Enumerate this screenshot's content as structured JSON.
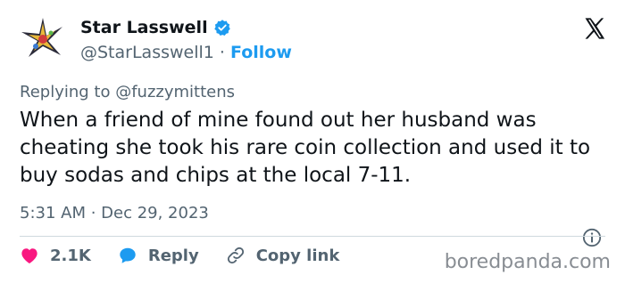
{
  "author": {
    "name": "Star Lasswell",
    "handle": "@StarLasswell1",
    "separator": "·",
    "follow_label": "Follow"
  },
  "tweet": {
    "replying_to": "Replying to @fuzzymittens",
    "text": "When a friend of mine found out her husband was cheating she took his rare coin collection and used it to buy sodas and chips at the local 7-11.",
    "timestamp": "5:31 AM · Dec 29, 2023"
  },
  "actions": {
    "likes_count": "2.1K",
    "reply_label": "Reply",
    "copy_link_label": "Copy link"
  },
  "watermark": "boredpanda.com",
  "colors": {
    "accent": "#1d9bf0",
    "like": "#f91880",
    "text": "#0f1419",
    "muted": "#536471"
  },
  "icons": {
    "avatar": "avatar",
    "verified": "verified-badge-icon",
    "logo": "x-logo-icon",
    "info": "info-icon",
    "like": "heart-icon",
    "reply": "reply-bubble-icon",
    "copy_link": "link-icon"
  }
}
